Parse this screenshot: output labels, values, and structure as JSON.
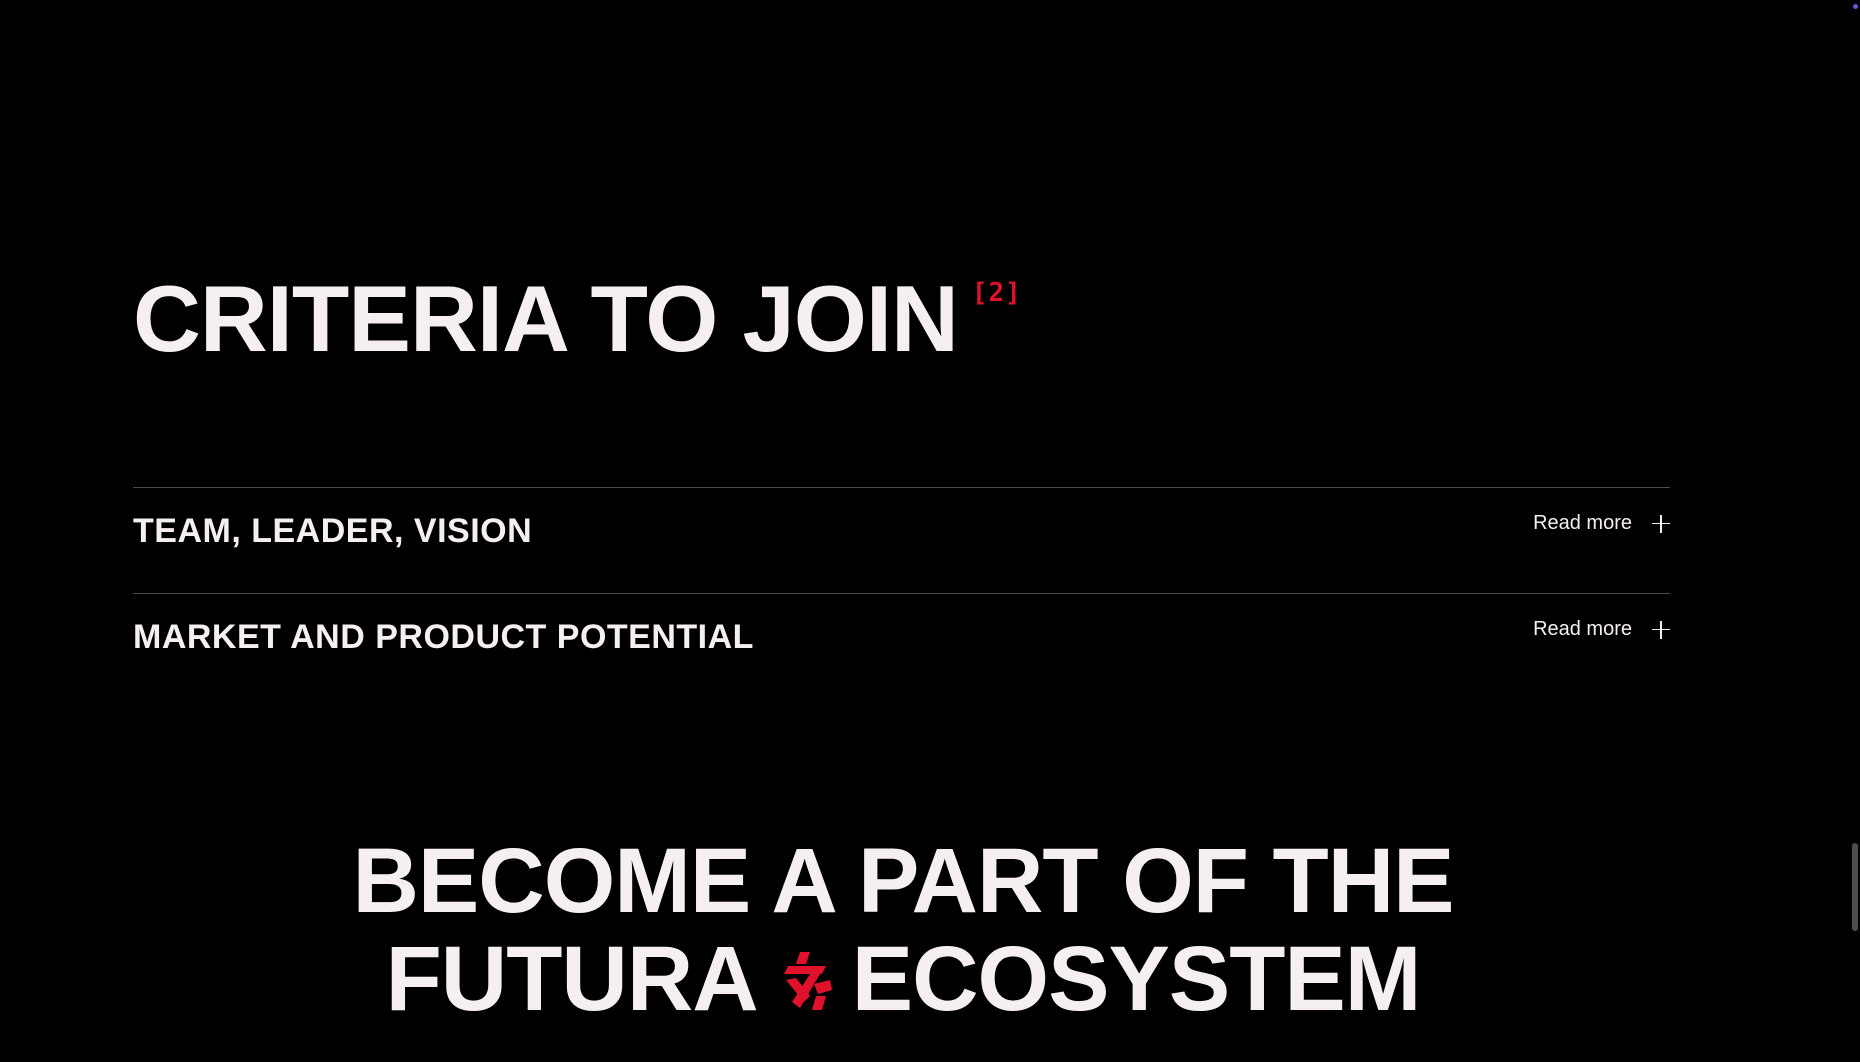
{
  "criteria": {
    "title": "CRITERIA TO JOIN",
    "badge": "[2]"
  },
  "accordion": {
    "items": [
      {
        "title": "TEAM, LEADER, VISION",
        "read_more": "Read more"
      },
      {
        "title": "MARKET AND PRODUCT POTENTIAL",
        "read_more": "Read more"
      }
    ]
  },
  "cta": {
    "line1": "BECOME A PART OF THE",
    "line2_before": "FUTURA",
    "line2_after": "ECOSYSTEM",
    "logo_icon": "futura-logo-icon"
  },
  "colors": {
    "background": "#000000",
    "text": "#f6eff2",
    "accent": "#e0122b",
    "divider": "#4a4a4a"
  }
}
